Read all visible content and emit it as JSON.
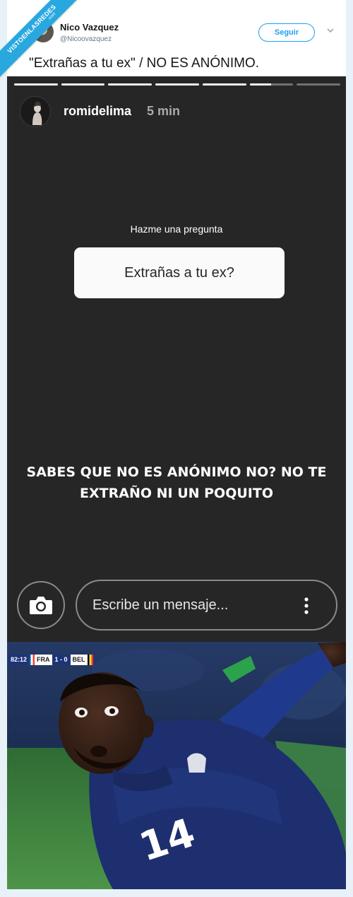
{
  "tweet": {
    "author_name": "Nico Vazquez",
    "author_handle": "@Nicoovazquez",
    "follow_label": "Seguir",
    "text": "\"Extrañas a tu ex\" / NO ES ANÓNIMO."
  },
  "watermark": {
    "main": "VISTOENLASREDES",
    "sub": ".com",
    "color": "#29a8e0"
  },
  "story": {
    "progress": {
      "segments": 7,
      "current_index": 5,
      "current_fraction": 0.5
    },
    "username": "romidelima",
    "time": "5 min",
    "question_label": "Hazme una pregunta",
    "question": "Extrañas a tu ex?",
    "answer": "SABES QUE NO ES ANÓNIMO NO? NO TE EXTRAÑO NI UN POQUITO",
    "message_placeholder": "Escribe un mensaje...",
    "icons": {
      "camera": "camera-icon",
      "more": "more-vertical-icon"
    }
  },
  "photo": {
    "scoreboard": {
      "time": "82:12",
      "home": "FRA",
      "score": "1 - 0",
      "away": "BEL"
    },
    "jersey_number": "14"
  }
}
